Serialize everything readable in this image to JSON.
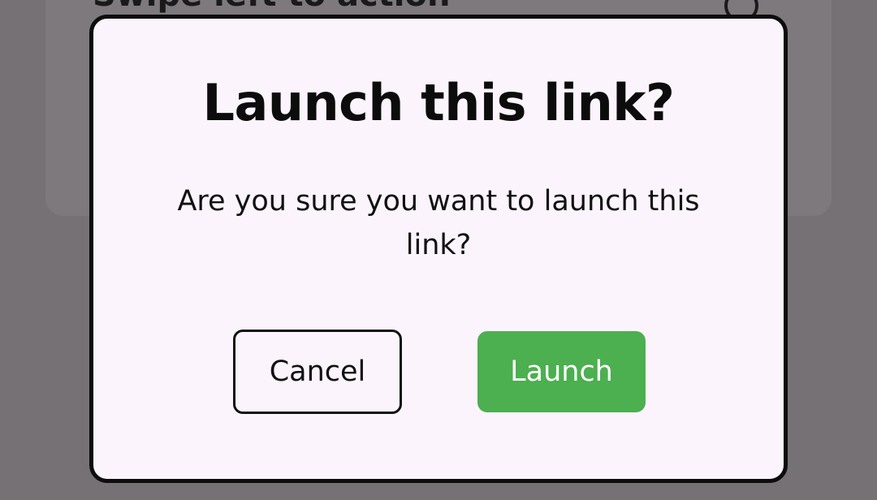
{
  "background_card": {
    "partial_text": "Swipe left to action",
    "check_icon": "check-circle-icon"
  },
  "dialog": {
    "title": "Launch this link?",
    "message": "Are you sure you want to launch this link?",
    "cancel_label": "Cancel",
    "launch_label": "Launch"
  },
  "colors": {
    "scrim": "#757174",
    "dialog_background": "#fcf4fc",
    "launch_button": "#4caf50",
    "border": "#0d0d0d"
  }
}
